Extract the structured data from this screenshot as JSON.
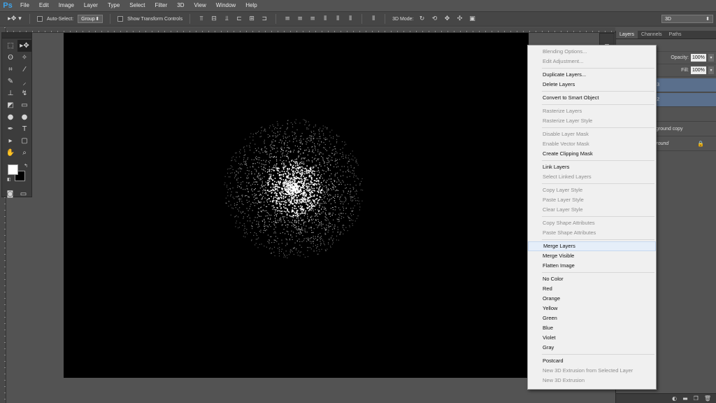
{
  "app": {
    "logo": "Ps"
  },
  "menubar": {
    "items": [
      "File",
      "Edit",
      "Image",
      "Layer",
      "Type",
      "Select",
      "Filter",
      "3D",
      "View",
      "Window",
      "Help"
    ]
  },
  "options": {
    "auto_select_label": "Auto-Select:",
    "auto_select_value": "Group",
    "transform_label": "Show Transform Controls",
    "mode_label": "3D Mode:",
    "workspace_value": "3D"
  },
  "layers_panel": {
    "tabs": [
      "Layers",
      "Channels",
      "Paths"
    ],
    "opacity_label": "Opacity:",
    "opacity_value": "100%",
    "fill_label": "Fill:",
    "fill_value": "100%",
    "layers": [
      {
        "name": "er 3",
        "selected": true
      },
      {
        "name": "er 2",
        "selected": true
      },
      {
        "name": "ck",
        "selected": false
      },
      {
        "name": "ckground copy",
        "selected": false
      },
      {
        "name": "kground",
        "selected": false,
        "locked": true
      }
    ]
  },
  "context_menu": {
    "groups": [
      [
        {
          "label": "Blending Options...",
          "disabled": true
        },
        {
          "label": "Edit Adjustment...",
          "disabled": true
        }
      ],
      [
        {
          "label": "Duplicate Layers...",
          "disabled": false
        },
        {
          "label": "Delete Layers",
          "disabled": false
        }
      ],
      [
        {
          "label": "Convert to Smart Object",
          "disabled": false
        }
      ],
      [
        {
          "label": "Rasterize Layers",
          "disabled": true
        },
        {
          "label": "Rasterize Layer Style",
          "disabled": true
        }
      ],
      [
        {
          "label": "Disable Layer Mask",
          "disabled": true
        },
        {
          "label": "Enable Vector Mask",
          "disabled": true
        },
        {
          "label": "Create Clipping Mask",
          "disabled": false
        }
      ],
      [
        {
          "label": "Link Layers",
          "disabled": false
        },
        {
          "label": "Select Linked Layers",
          "disabled": true
        }
      ],
      [
        {
          "label": "Copy Layer Style",
          "disabled": true
        },
        {
          "label": "Paste Layer Style",
          "disabled": true
        },
        {
          "label": "Clear Layer Style",
          "disabled": true
        }
      ],
      [
        {
          "label": "Copy Shape Attributes",
          "disabled": true
        },
        {
          "label": "Paste Shape Attributes",
          "disabled": true
        }
      ],
      [
        {
          "label": "Merge Layers",
          "disabled": false,
          "hover": true
        },
        {
          "label": "Merge Visible",
          "disabled": false
        },
        {
          "label": "Flatten Image",
          "disabled": false
        }
      ],
      [
        {
          "label": "No Color",
          "disabled": false
        },
        {
          "label": "Red",
          "disabled": false
        },
        {
          "label": "Orange",
          "disabled": false
        },
        {
          "label": "Yellow",
          "disabled": false
        },
        {
          "label": "Green",
          "disabled": false
        },
        {
          "label": "Blue",
          "disabled": false
        },
        {
          "label": "Violet",
          "disabled": false
        },
        {
          "label": "Gray",
          "disabled": false
        }
      ],
      [
        {
          "label": "Postcard",
          "disabled": false
        },
        {
          "label": "New 3D Extrusion from Selected Layer",
          "disabled": true
        },
        {
          "label": "New 3D Extrusion",
          "disabled": true
        }
      ]
    ]
  },
  "colors": {
    "foreground": "#ffffff",
    "background": "#000000",
    "canvas": "#000000",
    "selection": "#5a6f8c"
  }
}
